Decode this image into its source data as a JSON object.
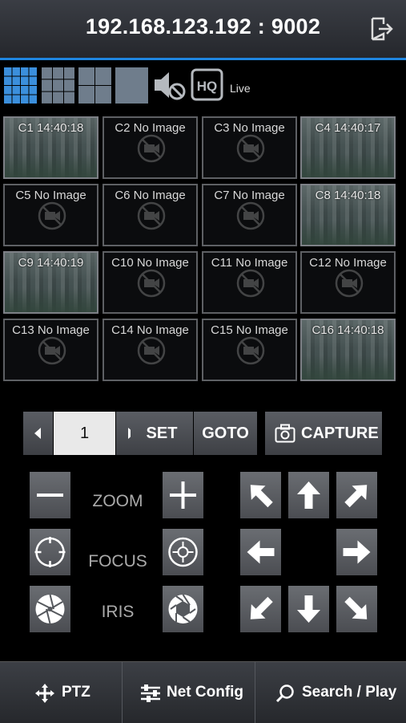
{
  "header": {
    "title": "192.168.123.192 : 9002"
  },
  "toolbar": {
    "live_label": "Live",
    "hq_label": "HQ"
  },
  "cameras": [
    {
      "label": "C1 14:40:18",
      "has_image": true
    },
    {
      "label": "C2 No Image",
      "has_image": false
    },
    {
      "label": "C3 No Image",
      "has_image": false
    },
    {
      "label": "C4 14:40:17",
      "has_image": true
    },
    {
      "label": "C5 No Image",
      "has_image": false
    },
    {
      "label": "C6 No Image",
      "has_image": false
    },
    {
      "label": "C7 No Image",
      "has_image": false
    },
    {
      "label": "C8 14:40:18",
      "has_image": true
    },
    {
      "label": "C9 14:40:19",
      "has_image": true
    },
    {
      "label": "C10 No Image",
      "has_image": false
    },
    {
      "label": "C11 No Image",
      "has_image": false
    },
    {
      "label": "C12 No Image",
      "has_image": false
    },
    {
      "label": "C13 No Image",
      "has_image": false
    },
    {
      "label": "C14 No Image",
      "has_image": false
    },
    {
      "label": "C15 No Image",
      "has_image": false
    },
    {
      "label": "C16 14:40:18",
      "has_image": true
    }
  ],
  "preset": {
    "value": "1",
    "set_label": "SET",
    "goto_label": "GOTO",
    "capture_label": "CAPTURE"
  },
  "controls": {
    "zoom_label": "ZOOM",
    "focus_label": "FOCUS",
    "iris_label": "IRIS"
  },
  "tabs": [
    {
      "label": "PTZ",
      "icon": "move-icon"
    },
    {
      "label": "Net Config",
      "icon": "sliders-icon"
    },
    {
      "label": "Search / Play",
      "icon": "magnifier-icon"
    }
  ],
  "colors": {
    "accent": "#1f86e0",
    "selected_layout": "#3b8fdc"
  }
}
